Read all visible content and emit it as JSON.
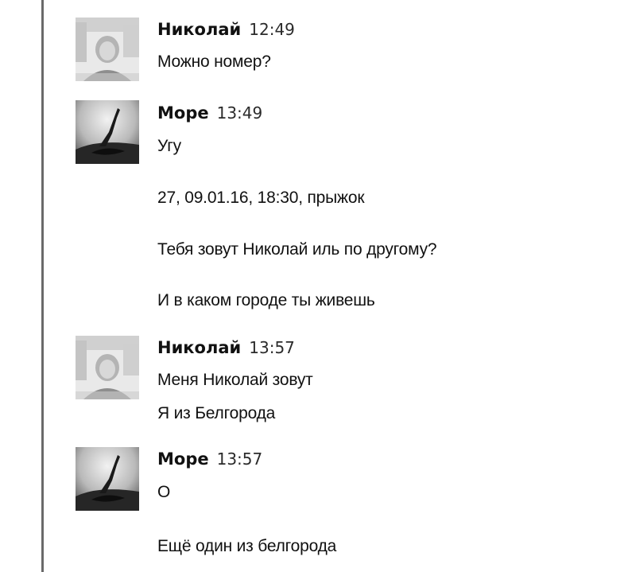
{
  "messages": [
    {
      "author": "Николай",
      "time": "12:49",
      "avatar": "nikolai-avatar",
      "lines": [
        "Можно номер?"
      ]
    },
    {
      "author": "Море",
      "time": "13:49",
      "avatar": "more-avatar",
      "lines": [
        "Угу",
        "27, 09.01.16, 18:30, прыжок",
        "Тебя зовут Николай иль по другому?",
        "И в каком городе ты живешь"
      ]
    },
    {
      "author": "Николай",
      "time": "13:57",
      "avatar": "nikolai-avatar",
      "lines": [
        "Меня Николай зовут",
        "Я из Белгорода"
      ]
    },
    {
      "author": "Море",
      "time": "13:57",
      "avatar": "more-avatar",
      "lines": [
        "О",
        "Ещё один из белгорода"
      ]
    }
  ]
}
